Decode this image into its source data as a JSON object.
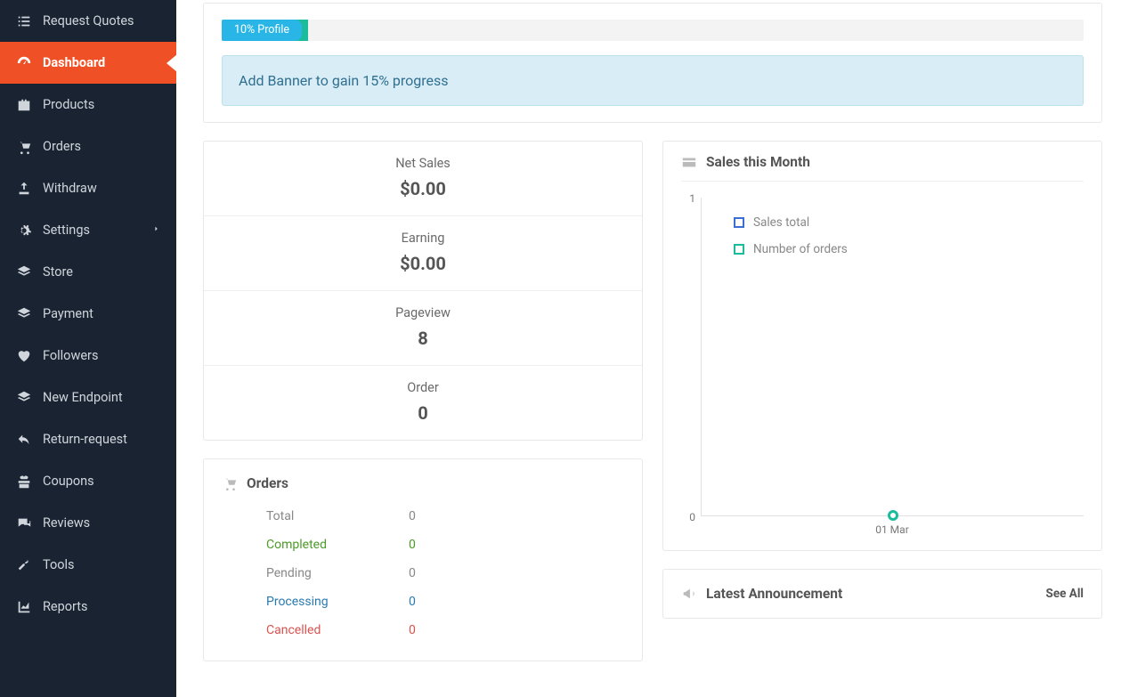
{
  "sidebar": {
    "items": [
      {
        "label": "Request Quotes",
        "icon": "list-icon",
        "active": false,
        "caret": false
      },
      {
        "label": "Dashboard",
        "icon": "dashboard-icon",
        "active": true,
        "caret": false
      },
      {
        "label": "Products",
        "icon": "briefcase-icon",
        "active": false,
        "caret": false
      },
      {
        "label": "Orders",
        "icon": "cart-icon",
        "active": false,
        "caret": false
      },
      {
        "label": "Withdraw",
        "icon": "upload-icon",
        "active": false,
        "caret": false
      },
      {
        "label": "Settings",
        "icon": "gear-icon",
        "active": false,
        "caret": true
      },
      {
        "label": "Store",
        "icon": "layers-icon",
        "active": false,
        "caret": false
      },
      {
        "label": "Payment",
        "icon": "layers-icon",
        "active": false,
        "caret": false
      },
      {
        "label": "Followers",
        "icon": "heart-icon",
        "active": false,
        "caret": false
      },
      {
        "label": "New Endpoint",
        "icon": "layers-icon",
        "active": false,
        "caret": false
      },
      {
        "label": "Return-request",
        "icon": "undo-icon",
        "active": false,
        "caret": false
      },
      {
        "label": "Coupons",
        "icon": "gift-icon",
        "active": false,
        "caret": false
      },
      {
        "label": "Reviews",
        "icon": "comments-icon",
        "active": false,
        "caret": false
      },
      {
        "label": "Tools",
        "icon": "wrench-icon",
        "active": false,
        "caret": false
      },
      {
        "label": "Reports",
        "icon": "chart-icon",
        "active": false,
        "caret": false
      }
    ]
  },
  "profile_progress": {
    "label": "10% Profile",
    "percent": 10,
    "alert": "Add Banner to gain 15% progress"
  },
  "stats": [
    {
      "label": "Net Sales",
      "value": "$0.00"
    },
    {
      "label": "Earning",
      "value": "$0.00"
    },
    {
      "label": "Pageview",
      "value": "8"
    },
    {
      "label": "Order",
      "value": "0"
    }
  ],
  "orders_panel": {
    "title": "Orders",
    "rows": [
      {
        "label": "Total",
        "value": "0",
        "cls": ""
      },
      {
        "label": "Completed",
        "value": "0",
        "cls": "completed"
      },
      {
        "label": "Pending",
        "value": "0",
        "cls": ""
      },
      {
        "label": "Processing",
        "value": "0",
        "cls": "processing"
      },
      {
        "label": "Cancelled",
        "value": "0",
        "cls": "cancelled"
      }
    ]
  },
  "sales_chart": {
    "title": "Sales this Month",
    "legend": [
      {
        "label": "Sales total",
        "color": "blue"
      },
      {
        "label": "Number of orders",
        "color": "teal"
      }
    ],
    "y_top": "1",
    "y_bottom": "0",
    "x_label": "01 Mar"
  },
  "announcement": {
    "title": "Latest Announcement",
    "see_all": "See All"
  },
  "chart_data": {
    "type": "line",
    "categories": [
      "01 Mar"
    ],
    "series": [
      {
        "name": "Sales total",
        "values": [
          0
        ]
      },
      {
        "name": "Number of orders",
        "values": [
          0
        ]
      }
    ],
    "title": "Sales this Month",
    "xlabel": "",
    "ylabel": "",
    "ylim": [
      0,
      1
    ]
  }
}
